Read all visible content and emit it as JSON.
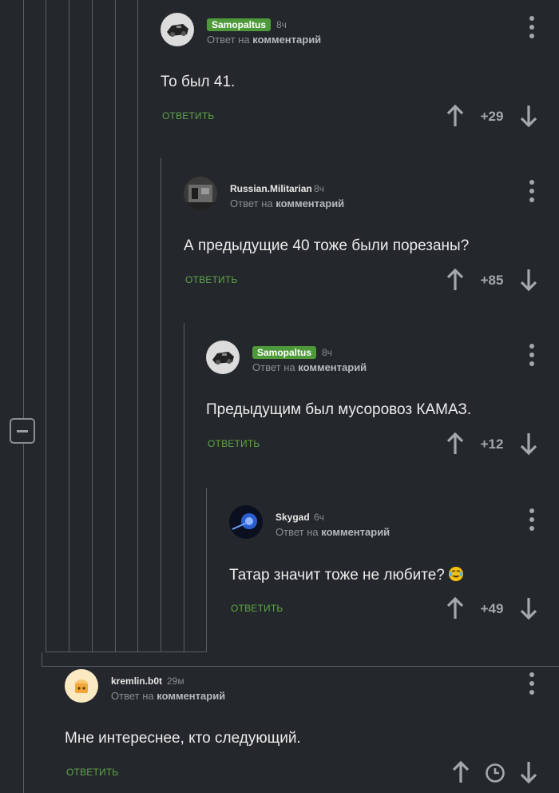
{
  "ui": {
    "reply_prefix": "Ответ на",
    "reply_target": "комментарий",
    "answer_label": "ОТВЕТИТЬ"
  },
  "comments": [
    {
      "user": "Samopaltus",
      "badge": true,
      "time": "8ч",
      "text": "То был 41.",
      "score": "+29"
    },
    {
      "user": "Russian.Militarian",
      "badge": false,
      "time": "8ч",
      "text": "А предыдущие 40 тоже были порезаны?",
      "score": "+85"
    },
    {
      "user": "Samopaltus",
      "badge": true,
      "time": "8ч",
      "text": "Предыдущим был мусоровоз КАМАЗ.",
      "score": "+12"
    },
    {
      "user": "Skygad",
      "badge": false,
      "time": "6ч",
      "text": "Татар значит тоже не любите?",
      "score": "+49",
      "emoji": "face-with-tears-of-joy"
    },
    {
      "user": "kremlin.b0t",
      "badge": false,
      "time": "29м",
      "text": "Мне интереснее, кто следующий.",
      "score_icon": "clock-icon"
    }
  ],
  "colors": {
    "background": "#24272b",
    "badge": "#4e9a3a",
    "answer_link": "#5fa64a",
    "thread_line": "#5b5f63"
  }
}
